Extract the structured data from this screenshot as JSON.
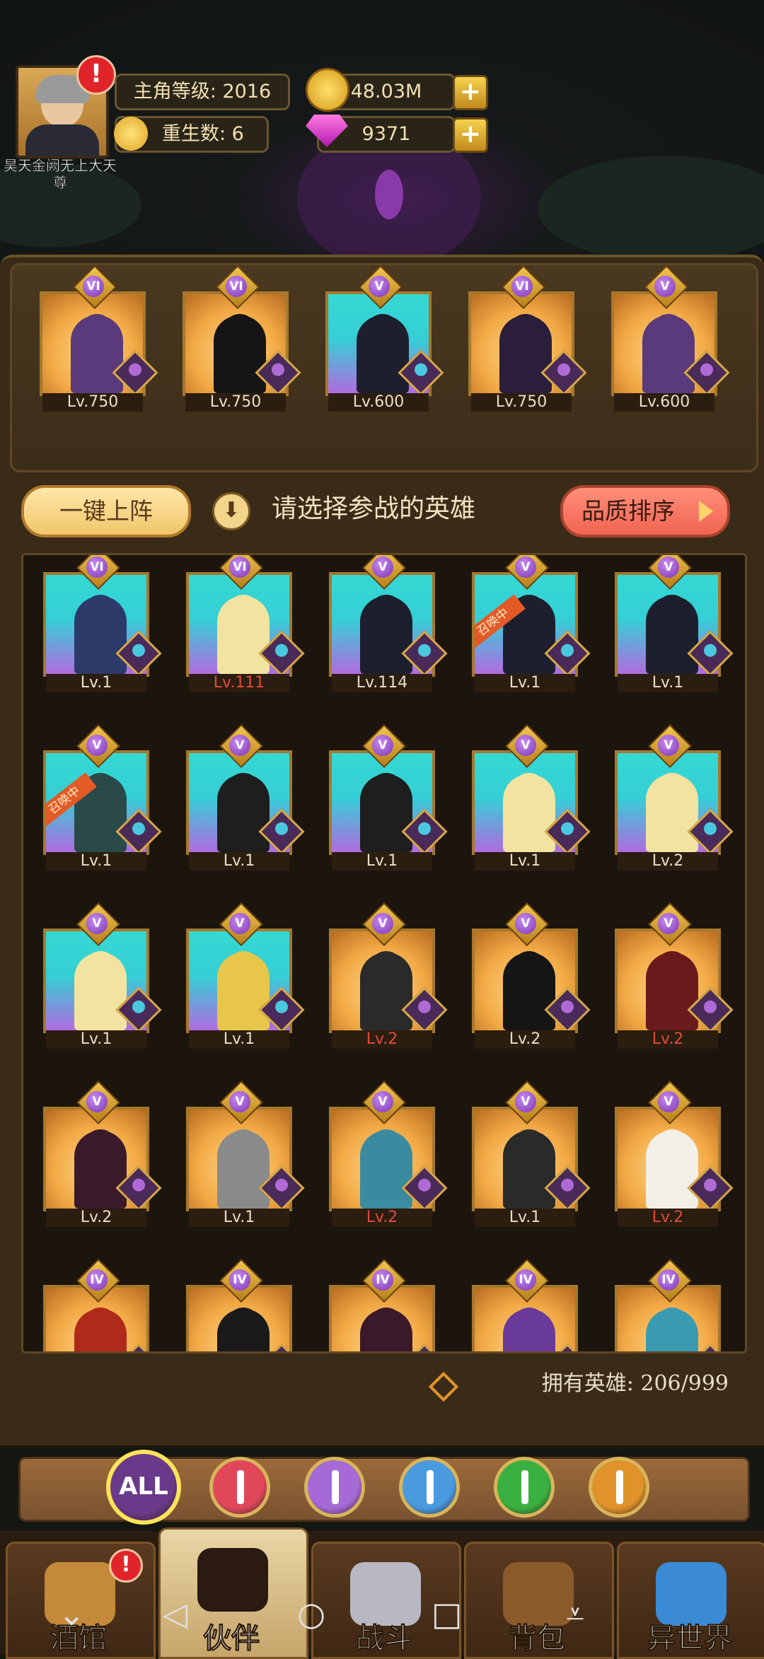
{
  "player": {
    "name": "昊天金阙无上大天尊",
    "level_label": "主角等级: 2016",
    "rebirth_label": "重生数: 6",
    "alert_mark": "!"
  },
  "currency": {
    "gold": "48.03M",
    "gems": "9371",
    "plus": "+"
  },
  "team": [
    {
      "rank": "VI",
      "level": "Lv.750",
      "bg": "gold",
      "body": "#5a3a7a"
    },
    {
      "rank": "VI",
      "level": "Lv.750",
      "bg": "gold",
      "body": "#151515"
    },
    {
      "rank": "V",
      "level": "Lv.600",
      "bg": "teal",
      "body": "#1d1f2e"
    },
    {
      "rank": "VI",
      "level": "Lv.750",
      "bg": "gold",
      "body": "#2a1e3a"
    },
    {
      "rank": "V",
      "level": "Lv.600",
      "bg": "gold",
      "body": "#5a3a7a"
    }
  ],
  "buttons": {
    "one_key": "一键上阵",
    "hint": "请选择参战的英雄",
    "sort": "品质排序"
  },
  "heroes": [
    {
      "rank": "VI",
      "level": "Lv.1",
      "bg": "teal",
      "body": "#2c3a6a",
      "red": false,
      "ribbon": ""
    },
    {
      "rank": "VI",
      "level": "Lv.111",
      "bg": "teal",
      "body": "#f2e4a0",
      "red": true,
      "ribbon": ""
    },
    {
      "rank": "V",
      "level": "Lv.114",
      "bg": "teal",
      "body": "#1d1f2e",
      "red": false,
      "ribbon": ""
    },
    {
      "rank": "V",
      "level": "Lv.1",
      "bg": "teal",
      "body": "#1d1f2e",
      "red": false,
      "ribbon": "召唤中"
    },
    {
      "rank": "V",
      "level": "Lv.1",
      "bg": "teal",
      "body": "#1d1f2e",
      "red": false,
      "ribbon": ""
    },
    {
      "rank": "V",
      "level": "Lv.1",
      "bg": "teal",
      "body": "#2a4a4a",
      "red": false,
      "ribbon": "召唤中"
    },
    {
      "rank": "V",
      "level": "Lv.1",
      "bg": "teal",
      "body": "#1e1e1e",
      "red": false,
      "ribbon": ""
    },
    {
      "rank": "V",
      "level": "Lv.1",
      "bg": "teal",
      "body": "#1e1e1e",
      "red": false,
      "ribbon": ""
    },
    {
      "rank": "V",
      "level": "Lv.1",
      "bg": "teal",
      "body": "#f2e4a0",
      "red": false,
      "ribbon": ""
    },
    {
      "rank": "V",
      "level": "Lv.2",
      "bg": "teal",
      "body": "#f2e4a0",
      "red": false,
      "ribbon": ""
    },
    {
      "rank": "V",
      "level": "Lv.1",
      "bg": "teal",
      "body": "#f2e4a0",
      "red": false,
      "ribbon": ""
    },
    {
      "rank": "V",
      "level": "Lv.1",
      "bg": "teal",
      "body": "#e8c64a",
      "red": false,
      "ribbon": ""
    },
    {
      "rank": "V",
      "level": "Lv.2",
      "bg": "gold",
      "body": "#2a2a2a",
      "red": true,
      "ribbon": ""
    },
    {
      "rank": "V",
      "level": "Lv.2",
      "bg": "gold",
      "body": "#151515",
      "red": false,
      "ribbon": ""
    },
    {
      "rank": "V",
      "level": "Lv.2",
      "bg": "gold",
      "body": "#6a1a1a",
      "red": true,
      "ribbon": ""
    },
    {
      "rank": "V",
      "level": "Lv.2",
      "bg": "gold",
      "body": "#3a1a2a",
      "red": false,
      "ribbon": ""
    },
    {
      "rank": "V",
      "level": "Lv.1",
      "bg": "gold",
      "body": "#8a8a8a",
      "red": false,
      "ribbon": ""
    },
    {
      "rank": "V",
      "level": "Lv.2",
      "bg": "gold",
      "body": "#3a8aa0",
      "red": true,
      "ribbon": ""
    },
    {
      "rank": "V",
      "level": "Lv.1",
      "bg": "gold",
      "body": "#2a2a2a",
      "red": false,
      "ribbon": ""
    },
    {
      "rank": "V",
      "level": "Lv.2",
      "bg": "gold",
      "body": "#f2efe6",
      "red": true,
      "ribbon": ""
    },
    {
      "rank": "IV",
      "level": "",
      "bg": "gold",
      "body": "#b02a1a",
      "red": false,
      "ribbon": ""
    },
    {
      "rank": "IV",
      "level": "",
      "bg": "gold",
      "body": "#1a1a1a",
      "red": false,
      "ribbon": ""
    },
    {
      "rank": "IV",
      "level": "",
      "bg": "gold",
      "body": "#3a1a2a",
      "red": false,
      "ribbon": ""
    },
    {
      "rank": "IV",
      "level": "",
      "bg": "gold",
      "body": "#6a3a9a",
      "red": false,
      "ribbon": ""
    },
    {
      "rank": "IV",
      "level": "",
      "bg": "gold",
      "body": "#3a9ab0",
      "red": false,
      "ribbon": ""
    }
  ],
  "owned_label": "拥有英雄: 206/999",
  "filters": [
    {
      "name": "all",
      "label": "ALL",
      "color": "#6a3a8a"
    },
    {
      "name": "sword",
      "label": "",
      "color": "#e0485a"
    },
    {
      "name": "staff",
      "label": "",
      "color": "#a66ad6"
    },
    {
      "name": "dagger",
      "label": "",
      "color": "#4a9ae0"
    },
    {
      "name": "heal",
      "label": "",
      "color": "#3ab040"
    },
    {
      "name": "shield",
      "label": "",
      "color": "#e0932a"
    }
  ],
  "nav": [
    {
      "name": "tavern",
      "label": "酒馆"
    },
    {
      "name": "partner",
      "label": "伙伴"
    },
    {
      "name": "battle",
      "label": "战斗"
    },
    {
      "name": "bag",
      "label": "背包"
    },
    {
      "name": "otherworld",
      "label": "异世界"
    }
  ],
  "nav_alert": "!",
  "system_nav": {
    "down": "⌄",
    "back": "◁",
    "home": "○",
    "recent": "□",
    "menu": "⩡"
  }
}
